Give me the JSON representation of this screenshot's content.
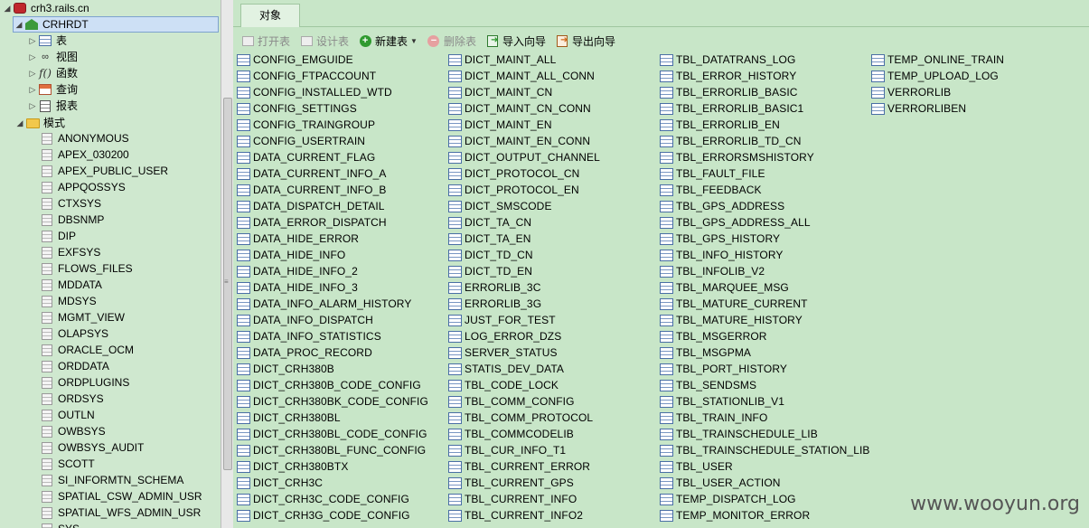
{
  "tree": {
    "connection": "crh3.rails.cn",
    "database": "CRHRDT",
    "categories": [
      "表",
      "视图",
      "函数",
      "查询",
      "报表"
    ],
    "schema_folder": "模式",
    "schemas": [
      "ANONYMOUS",
      "APEX_030200",
      "APEX_PUBLIC_USER",
      "APPQOSSYS",
      "CTXSYS",
      "DBSNMP",
      "DIP",
      "EXFSYS",
      "FLOWS_FILES",
      "MDDATA",
      "MDSYS",
      "MGMT_VIEW",
      "OLAPSYS",
      "ORACLE_OCM",
      "ORDDATA",
      "ORDPLUGINS",
      "ORDSYS",
      "OUTLN",
      "OWBSYS",
      "OWBSYS_AUDIT",
      "SCOTT",
      "SI_INFORMTN_SCHEMA",
      "SPATIAL_CSW_ADMIN_USR",
      "SPATIAL_WFS_ADMIN_USR",
      "SYS"
    ]
  },
  "tabs": [
    "对象"
  ],
  "toolbar": {
    "open_table": "打开表",
    "design_table": "设计表",
    "new_table": "新建表",
    "delete_table": "删除表",
    "import_wizard": "导入向导",
    "export_wizard": "导出向导"
  },
  "objects": {
    "col1": [
      "CONFIG_EMGUIDE",
      "CONFIG_FTPACCOUNT",
      "CONFIG_INSTALLED_WTD",
      "CONFIG_SETTINGS",
      "CONFIG_TRAINGROUP",
      "CONFIG_USERTRAIN",
      "DATA_CURRENT_FLAG",
      "DATA_CURRENT_INFO_A",
      "DATA_CURRENT_INFO_B",
      "DATA_DISPATCH_DETAIL",
      "DATA_ERROR_DISPATCH",
      "DATA_HIDE_ERROR",
      "DATA_HIDE_INFO",
      "DATA_HIDE_INFO_2",
      "DATA_HIDE_INFO_3",
      "DATA_INFO_ALARM_HISTORY",
      "DATA_INFO_DISPATCH",
      "DATA_INFO_STATISTICS",
      "DATA_PROC_RECORD",
      "DICT_CRH380B",
      "DICT_CRH380B_CODE_CONFIG",
      "DICT_CRH380BK_CODE_CONFIG",
      "DICT_CRH380BL",
      "DICT_CRH380BL_CODE_CONFIG",
      "DICT_CRH380BL_FUNC_CONFIG",
      "DICT_CRH380BTX",
      "DICT_CRH3C",
      "DICT_CRH3C_CODE_CONFIG",
      "DICT_CRH3G_CODE_CONFIG"
    ],
    "col2": [
      "DICT_MAINT_ALL",
      "DICT_MAINT_ALL_CONN",
      "DICT_MAINT_CN",
      "DICT_MAINT_CN_CONN",
      "DICT_MAINT_EN",
      "DICT_MAINT_EN_CONN",
      "DICT_OUTPUT_CHANNEL",
      "DICT_PROTOCOL_CN",
      "DICT_PROTOCOL_EN",
      "DICT_SMSCODE",
      "DICT_TA_CN",
      "DICT_TA_EN",
      "DICT_TD_CN",
      "DICT_TD_EN",
      "ERRORLIB_3C",
      "ERRORLIB_3G",
      "JUST_FOR_TEST",
      "LOG_ERROR_DZS",
      "SERVER_STATUS",
      "STATIS_DEV_DATA",
      "TBL_CODE_LOCK",
      "TBL_COMM_CONFIG",
      "TBL_COMM_PROTOCOL",
      "TBL_COMMCODELIB",
      "TBL_CUR_INFO_T1",
      "TBL_CURRENT_ERROR",
      "TBL_CURRENT_GPS",
      "TBL_CURRENT_INFO",
      "TBL_CURRENT_INFO2"
    ],
    "col3": [
      "TBL_DATATRANS_LOG",
      "TBL_ERROR_HISTORY",
      "TBL_ERRORLIB_BASIC",
      "TBL_ERRORLIB_BASIC1",
      "TBL_ERRORLIB_EN",
      "TBL_ERRORLIB_TD_CN",
      "TBL_ERRORSMSHISTORY",
      "TBL_FAULT_FILE",
      "TBL_FEEDBACK",
      "TBL_GPS_ADDRESS",
      "TBL_GPS_ADDRESS_ALL",
      "TBL_GPS_HISTORY",
      "TBL_INFO_HISTORY",
      "TBL_INFOLIB_V2",
      "TBL_MARQUEE_MSG",
      "TBL_MATURE_CURRENT",
      "TBL_MATURE_HISTORY",
      "TBL_MSGERROR",
      "TBL_MSGPMA",
      "TBL_PORT_HISTORY",
      "TBL_SENDSMS",
      "TBL_STATIONLIB_V1",
      "TBL_TRAIN_INFO",
      "TBL_TRAINSCHEDULE_LIB",
      "TBL_TRAINSCHEDULE_STATION_LIB",
      "TBL_USER",
      "TBL_USER_ACTION",
      "TEMP_DISPATCH_LOG",
      "TEMP_MONITOR_ERROR"
    ],
    "col4": [
      "TEMP_ONLINE_TRAIN",
      "TEMP_UPLOAD_LOG",
      "VERRORLIB",
      "VERRORLIBEN"
    ]
  },
  "watermark": "www.wooyun.org"
}
